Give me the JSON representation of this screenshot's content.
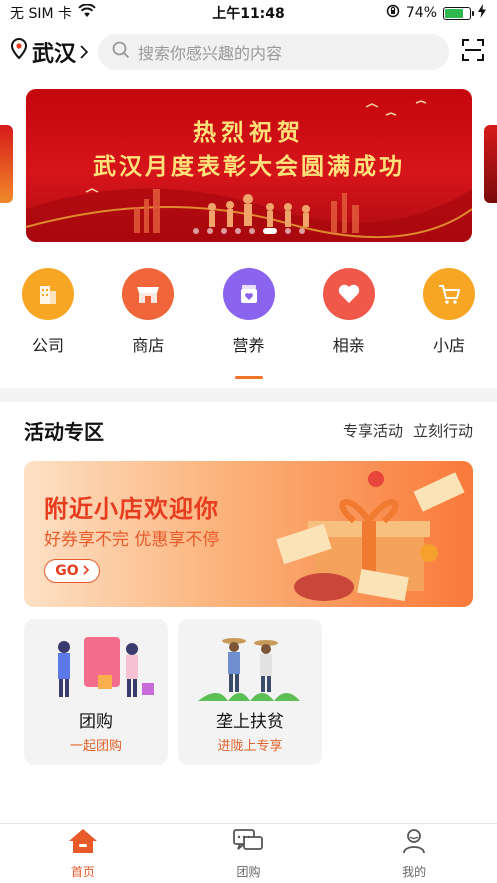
{
  "status_bar": {
    "carrier": "无 SIM 卡",
    "time": "上午11:48",
    "battery_text": "74%",
    "battery_level": 0.74
  },
  "header": {
    "city": "武汉",
    "search_placeholder": "搜索你感兴趣的内容"
  },
  "banner": {
    "line1": "热烈祝贺",
    "line2": "武汉月度表彰大会圆满成功",
    "slides": 8,
    "active_slide": 5
  },
  "categories": [
    {
      "label": "公司",
      "icon": "building-icon",
      "color": "#f6a623"
    },
    {
      "label": "商店",
      "icon": "store-icon",
      "color": "#f0663a"
    },
    {
      "label": "营养",
      "icon": "nutrition-icon",
      "color": "#8a63ee"
    },
    {
      "label": "相亲",
      "icon": "heart-icon",
      "color": "#f0584a"
    },
    {
      "label": "小店",
      "icon": "cart-icon",
      "color": "#f6a623"
    }
  ],
  "activity": {
    "title": "活动专区",
    "links": [
      "专享活动",
      "立刻行动"
    ],
    "promo": {
      "title": "附近小店欢迎你",
      "subtitle": "好券享不完 优惠享不停",
      "button": "GO"
    },
    "cards": [
      {
        "name": "团购",
        "sub": "一起团购"
      },
      {
        "name": "垄上扶贫",
        "sub": "进陇上专享"
      }
    ]
  },
  "tabs": [
    {
      "label": "首页",
      "icon": "home-icon",
      "active": true
    },
    {
      "label": "团购",
      "icon": "chat-icon",
      "active": false
    },
    {
      "label": "我的",
      "icon": "user-icon",
      "active": false
    }
  ],
  "colors": {
    "accent": "#e85a2a",
    "banner_red": "#c4060d"
  }
}
